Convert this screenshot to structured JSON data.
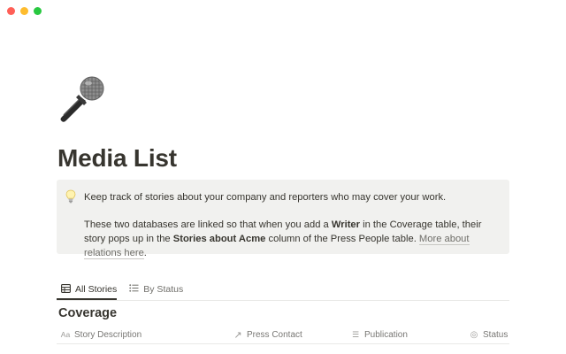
{
  "window": {
    "traffic_lights": {
      "close": "#ff5f57",
      "minimize": "#febc2e",
      "zoom": "#28c840"
    }
  },
  "page": {
    "icon": "microphone-icon",
    "title": "Media List"
  },
  "callout": {
    "icon": "lightbulb-icon",
    "line1": "Keep track of stories about your company and reporters who may cover your work.",
    "line2_part1": "These two databases are linked so that when you add a ",
    "line2_bold1": "Writer",
    "line2_part2": " in the Coverage table, their story pops up in the ",
    "line2_bold2": "Stories about Acme",
    "line2_part3": " column of the Press People table. ",
    "line2_link": "More about relations here",
    "line2_end": "."
  },
  "views": {
    "tabs": [
      {
        "label": "All Stories",
        "icon": "table-icon",
        "active": true
      },
      {
        "label": "By Status",
        "icon": "list-icon",
        "active": false
      }
    ]
  },
  "database": {
    "title": "Coverage",
    "columns": [
      {
        "label": "Story Description",
        "icon": "text-type-icon",
        "icon_text": "Aa"
      },
      {
        "label": "Press Contact",
        "icon": "relation-arrow-icon",
        "icon_text": "↗"
      },
      {
        "label": "Publication",
        "icon": "list-icon",
        "icon_text": "☰"
      },
      {
        "label": "Status",
        "icon": "status-icon",
        "icon_text": "◎"
      }
    ]
  }
}
